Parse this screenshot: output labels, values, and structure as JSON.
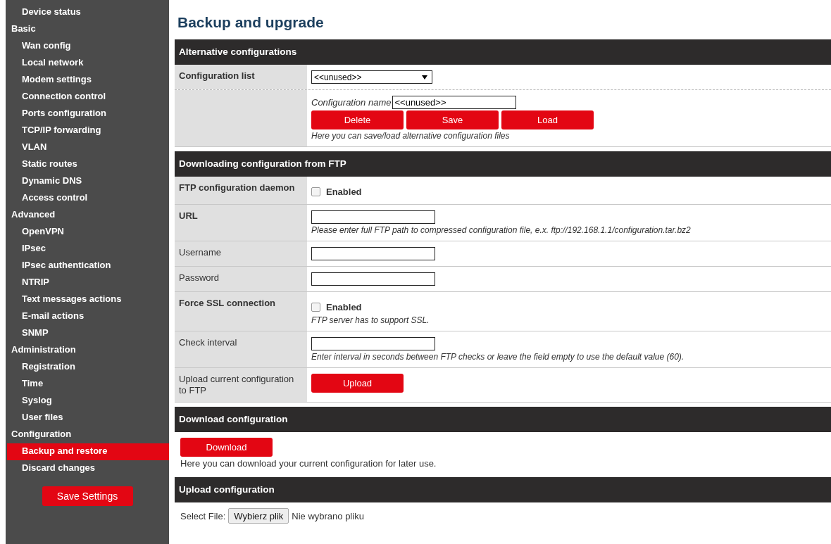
{
  "sidebar": {
    "items": [
      {
        "kind": "item",
        "label": "Device status",
        "selected": false
      },
      {
        "kind": "group",
        "label": "Basic",
        "selected": false
      },
      {
        "kind": "item",
        "label": "Wan config",
        "selected": false
      },
      {
        "kind": "item",
        "label": "Local network",
        "selected": false
      },
      {
        "kind": "item",
        "label": "Modem settings",
        "selected": false
      },
      {
        "kind": "item",
        "label": "Connection control",
        "selected": false
      },
      {
        "kind": "item",
        "label": "Ports configuration",
        "selected": false
      },
      {
        "kind": "item",
        "label": "TCP/IP forwarding",
        "selected": false
      },
      {
        "kind": "item",
        "label": "VLAN",
        "selected": false
      },
      {
        "kind": "item",
        "label": "Static routes",
        "selected": false
      },
      {
        "kind": "item",
        "label": "Dynamic DNS",
        "selected": false
      },
      {
        "kind": "item",
        "label": "Access control",
        "selected": false
      },
      {
        "kind": "group",
        "label": "Advanced",
        "selected": false
      },
      {
        "kind": "item",
        "label": "OpenVPN",
        "selected": false
      },
      {
        "kind": "item",
        "label": "IPsec",
        "selected": false
      },
      {
        "kind": "item",
        "label": "IPsec authentication",
        "selected": false
      },
      {
        "kind": "item",
        "label": "NTRIP",
        "selected": false
      },
      {
        "kind": "item",
        "label": "Text messages actions",
        "selected": false
      },
      {
        "kind": "item",
        "label": "E-mail actions",
        "selected": false
      },
      {
        "kind": "item",
        "label": "SNMP",
        "selected": false
      },
      {
        "kind": "group",
        "label": "Administration",
        "selected": false
      },
      {
        "kind": "item",
        "label": "Registration",
        "selected": false
      },
      {
        "kind": "item",
        "label": "Time",
        "selected": false
      },
      {
        "kind": "item",
        "label": "Syslog",
        "selected": false
      },
      {
        "kind": "item",
        "label": "User files",
        "selected": false
      },
      {
        "kind": "group",
        "label": "Configuration",
        "selected": false
      },
      {
        "kind": "item",
        "label": "Backup and restore",
        "selected": true
      },
      {
        "kind": "item",
        "label": "Discard changes",
        "selected": false
      }
    ],
    "save_button": "Save Settings"
  },
  "page_title": "Backup and upgrade",
  "sections": [
    {
      "title": "Alternative configurations",
      "kind": "table",
      "rows": [
        {
          "label": "Configuration list",
          "bold": true,
          "dashed": true,
          "items": [
            {
              "kind": "select",
              "value": "<<unused>>"
            }
          ]
        },
        {
          "dashed": false,
          "items": [
            {
              "kind": "named-input",
              "label": "Configuration name",
              "value": "<<unused>>"
            },
            {
              "kind": "buttons",
              "labels": [
                "Delete",
                "Save",
                "Load"
              ]
            },
            {
              "kind": "hint",
              "text": "Here you can save/load alternative configuration files"
            }
          ]
        }
      ]
    },
    {
      "title": "Downloading configuration from FTP",
      "kind": "table",
      "rows": [
        {
          "label": "FTP configuration daemon",
          "bold": true,
          "dashed": false,
          "items": [
            {
              "kind": "checkbox",
              "label": "Enabled",
              "checked": false
            }
          ]
        },
        {
          "label": "URL",
          "bold": true,
          "dashed": false,
          "items": [
            {
              "kind": "input",
              "value": ""
            },
            {
              "kind": "hint",
              "text": "Please enter full FTP path to compressed configuration file, e.x. ftp://192.168.1.1/configuration.tar.bz2"
            }
          ]
        },
        {
          "label": "Username",
          "bold": false,
          "dashed": false,
          "items": [
            {
              "kind": "input",
              "value": ""
            }
          ]
        },
        {
          "label": "Password",
          "bold": false,
          "dashed": false,
          "items": [
            {
              "kind": "input",
              "value": ""
            }
          ]
        },
        {
          "label": "Force SSL connection",
          "bold": true,
          "dashed": false,
          "items": [
            {
              "kind": "checkbox",
              "label": "Enabled",
              "checked": false
            },
            {
              "kind": "hint",
              "text": "FTP server has to support SSL."
            }
          ]
        },
        {
          "label": "Check interval",
          "bold": false,
          "dashed": false,
          "items": [
            {
              "kind": "input",
              "value": ""
            },
            {
              "kind": "hint",
              "text": "Enter interval in seconds between FTP checks or leave the field empty to use the default value (60)."
            }
          ]
        },
        {
          "label": "Upload current configuration to FTP",
          "bold": false,
          "dashed": false,
          "items": [
            {
              "kind": "button",
              "label": "Upload"
            }
          ]
        }
      ]
    },
    {
      "title": "Download configuration",
      "kind": "plain",
      "items": [
        {
          "kind": "button",
          "label": "Download"
        },
        {
          "kind": "text",
          "text": "Here you can download your current configuration for later use."
        }
      ]
    },
    {
      "title": "Upload configuration",
      "kind": "plain",
      "items": [
        {
          "kind": "file",
          "label": "Select File:",
          "button": "Wybierz plik",
          "status": "Nie wybrano pliku"
        }
      ]
    }
  ]
}
